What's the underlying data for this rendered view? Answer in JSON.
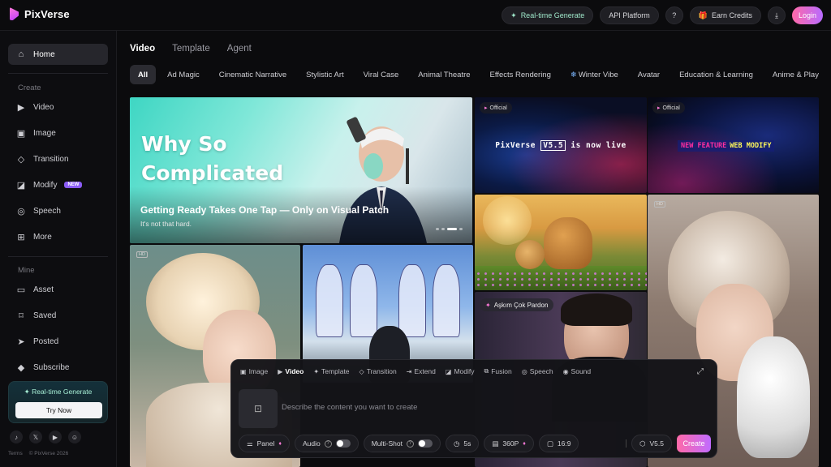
{
  "app": {
    "name": "PixVerse"
  },
  "header": {
    "realtime_label": "Real-time Generate",
    "api_label": "API Platform",
    "credits_label": "Earn Credits",
    "login_label": "Login"
  },
  "sidebar": {
    "home": "Home",
    "create_label": "Create",
    "create_items": [
      "Video",
      "Image",
      "Transition",
      "Modify",
      "Speech",
      "More"
    ],
    "modify_badge": "NEW",
    "mine_label": "Mine",
    "mine_items": [
      "Asset",
      "Saved",
      "Posted",
      "Subscribe"
    ],
    "promo_title": "Real-time Generate",
    "promo_button": "Try Now",
    "footer_terms": "Terms",
    "footer_copy": "© PixVerse 2026"
  },
  "main": {
    "tabs": [
      "Video",
      "Template",
      "Agent"
    ],
    "chips": [
      "All",
      "Ad Magic",
      "Cinematic Narrative",
      "Stylistic Art",
      "Viral Case",
      "Animal Theatre",
      "Effects Rendering",
      "Winter Vibe",
      "Avatar",
      "Education & Learning",
      "Anime & Play"
    ]
  },
  "feed": {
    "hero_title_1": "Why So",
    "hero_title_2": "Complicated",
    "hero_subtitle": "Getting Ready Takes One Tap — Only on Visual Patch",
    "hero_caption": "It's not that hard.",
    "official_label": "Official",
    "banner1_prefix": "PixVerse",
    "banner1_version": "V5.5",
    "banner1_suffix": "is now live",
    "banner2_part1": "NEW FEATURE",
    "banner2_part2": "WEB MODIFY",
    "hd_label": "HD",
    "askim_label": "Aşkım Çok Pardon"
  },
  "panel": {
    "tabs": [
      "Image",
      "Video",
      "Template",
      "Transition",
      "Extend",
      "Modify",
      "Fusion",
      "Speech",
      "Sound"
    ],
    "prompt_placeholder": "Describe the content you want to create",
    "panel_label": "Panel",
    "audio_label": "Audio",
    "multishot_label": "Multi-Shot",
    "duration": "5s",
    "resolution": "360P",
    "ratio": "16:9",
    "model": "V5.5",
    "create_label": "Create"
  }
}
